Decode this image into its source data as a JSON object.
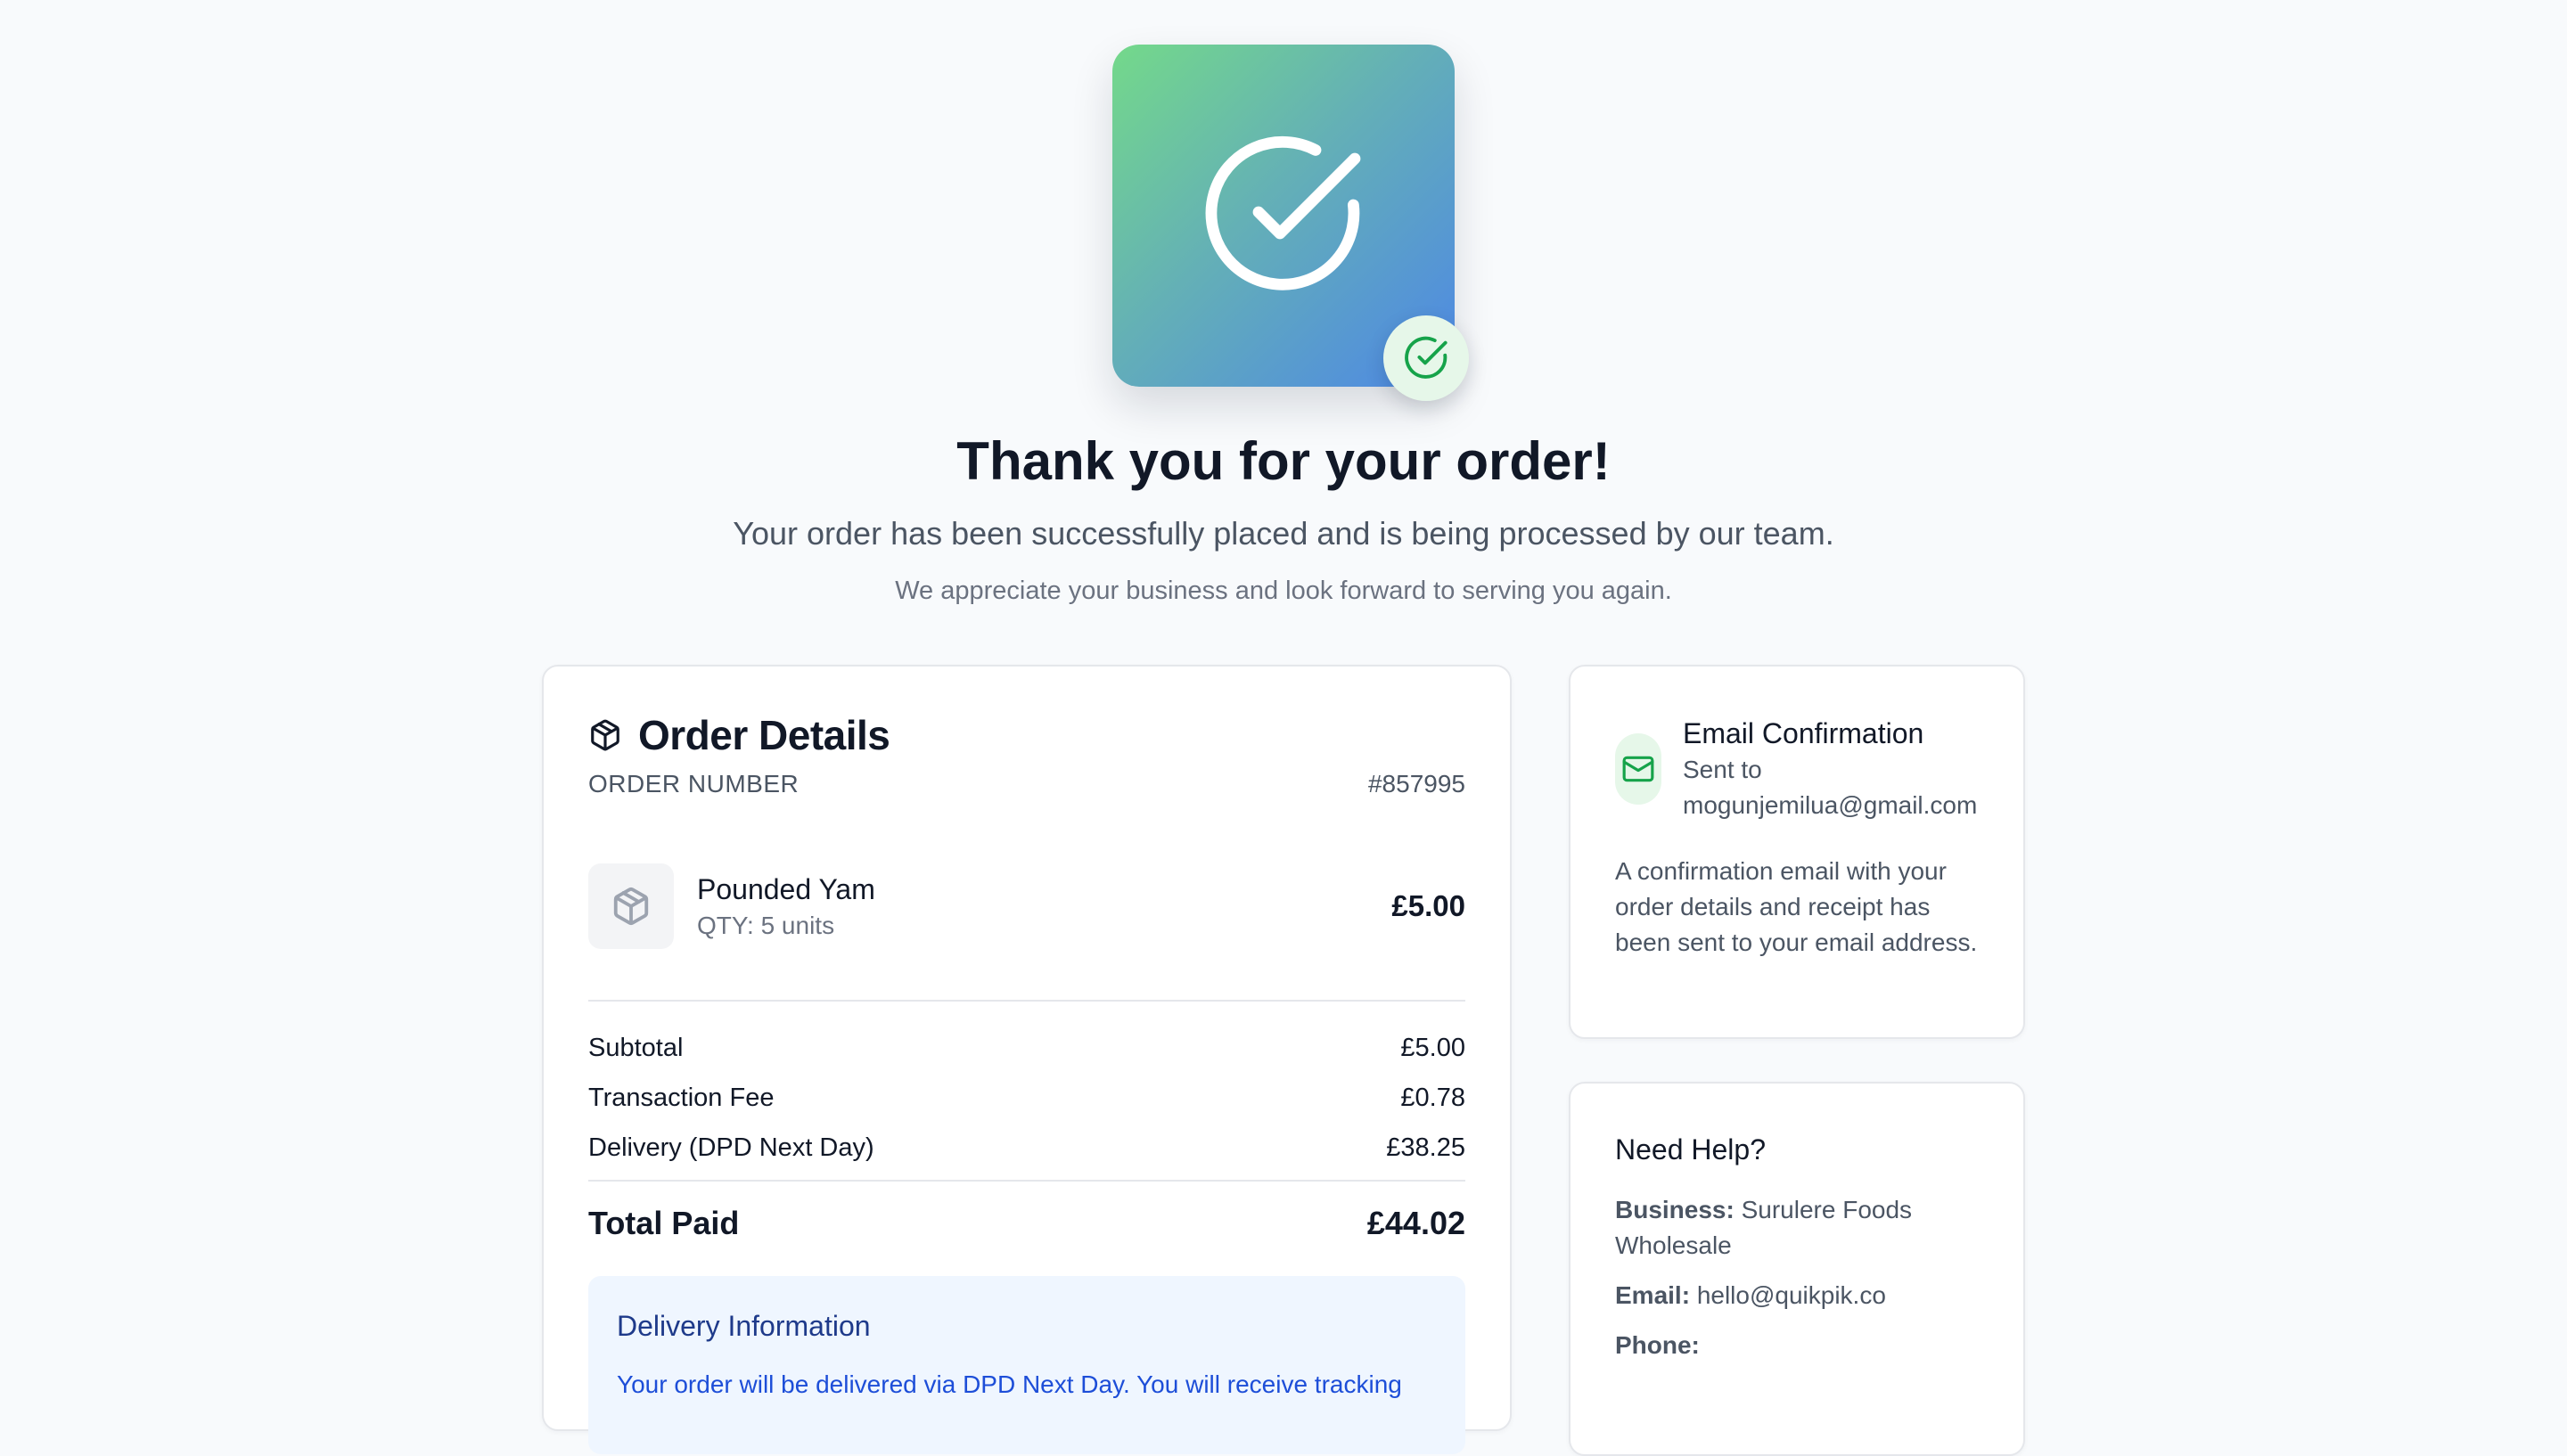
{
  "hero": {
    "title": "Thank you for your order!",
    "subtitle": "Your order has been successfully placed and is being processed by our team.",
    "note": "We appreciate your business and look forward to serving you again.",
    "icon": "check-circle-icon",
    "badge_icon": "check-circle-icon"
  },
  "order": {
    "title": "Order Details",
    "icon": "package-icon",
    "number_label": "ORDER NUMBER",
    "number": "#857995",
    "items": [
      {
        "name": "Pounded Yam",
        "qty": "QTY: 5 units",
        "price": "£5.00",
        "icon": "package-icon"
      }
    ],
    "summary": {
      "subtotal_label": "Subtotal",
      "subtotal": "£5.00",
      "fee_label": "Transaction Fee",
      "fee": "£0.78",
      "delivery_label": "Delivery (DPD Next Day)",
      "delivery": "£38.25",
      "total_label": "Total Paid",
      "total": "£44.02"
    },
    "delivery_info": {
      "title": "Delivery Information",
      "text": "Your order will be delivered via DPD Next Day. You will receive tracking"
    }
  },
  "email": {
    "title": "Email Confirmation",
    "sent_to": "Sent to",
    "address": "mogunjemilua@gmail.com",
    "description": "A confirmation email with your order details and receipt has been sent to your email address.",
    "icon": "mail-icon"
  },
  "help": {
    "title": "Need Help?",
    "business_label": "Business:",
    "business": "Surulere Foods Wholesale",
    "email_label": "Email:",
    "email": "hello@quikpik.co",
    "phone_label": "Phone:",
    "phone": ""
  },
  "colors": {
    "background": "#f8fafc",
    "accent_green": "#16a34a",
    "gradient_start": "#74d98a",
    "gradient_end": "#4d87e6",
    "delivery_bg": "#eff6ff",
    "delivery_text": "#1d4ed8"
  }
}
